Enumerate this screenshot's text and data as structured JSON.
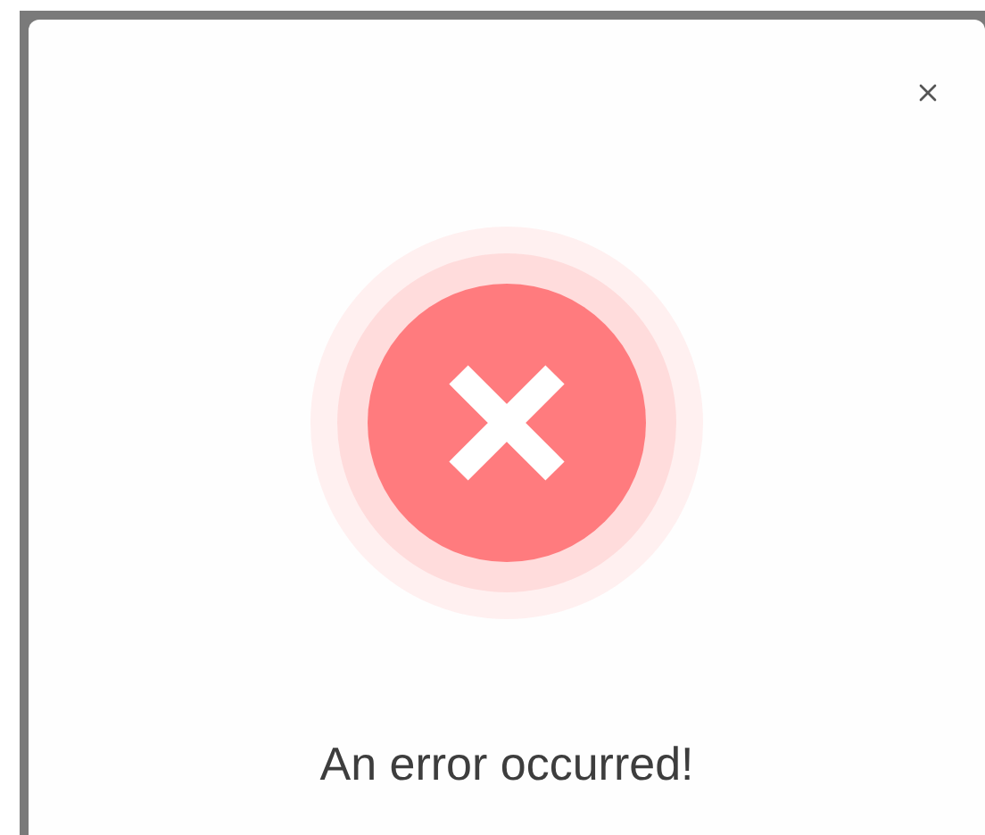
{
  "dialog": {
    "kind": "error",
    "message": "An error occurred!"
  }
}
